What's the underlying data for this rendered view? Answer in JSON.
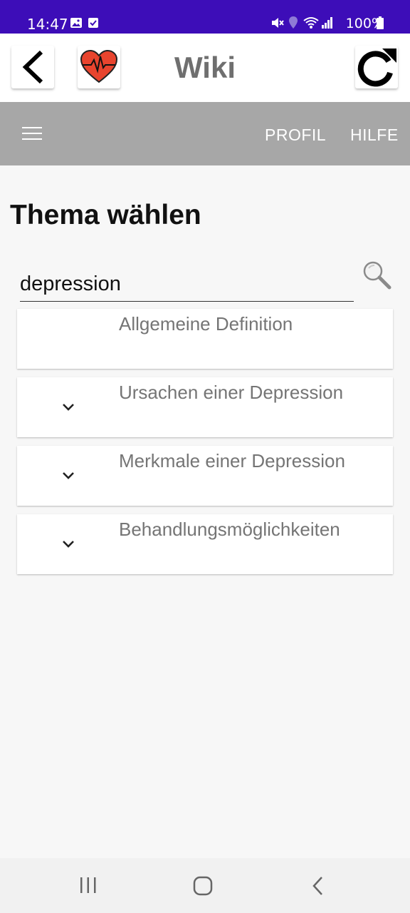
{
  "status_bar": {
    "time": "14:47",
    "battery": "100%",
    "icons": [
      "image-icon",
      "checkbox-icon",
      "mute-icon",
      "location-icon",
      "wifi-icon",
      "signal-icon",
      "battery-icon"
    ]
  },
  "app_bar": {
    "title": "Wiki",
    "back_icon": "back-arrow-icon",
    "logo_icon": "heart-pulse-icon",
    "refresh_icon": "refresh-icon"
  },
  "toolbar": {
    "menu_icon": "hamburger-menu-icon",
    "links": [
      "PROFIL",
      "HILFE"
    ]
  },
  "main": {
    "heading": "Thema wählen",
    "search": {
      "value": "depression",
      "placeholder": ""
    },
    "topics": [
      {
        "label": "Allgemeine Definition",
        "expandable": false
      },
      {
        "label": "Ursachen einer Depression",
        "expandable": true
      },
      {
        "label": "Merkmale einer Depression",
        "expandable": true
      },
      {
        "label": "Behandlungsmöglichkeiten",
        "expandable": true
      }
    ]
  },
  "nav_bar": {
    "icons": [
      "recent-apps-icon",
      "home-icon",
      "system-back-icon"
    ]
  },
  "colors": {
    "status_bar": "#3d0db8",
    "toolbar": "#a7a7a7",
    "heart": "#e8442e",
    "background": "#f7f7f7"
  }
}
